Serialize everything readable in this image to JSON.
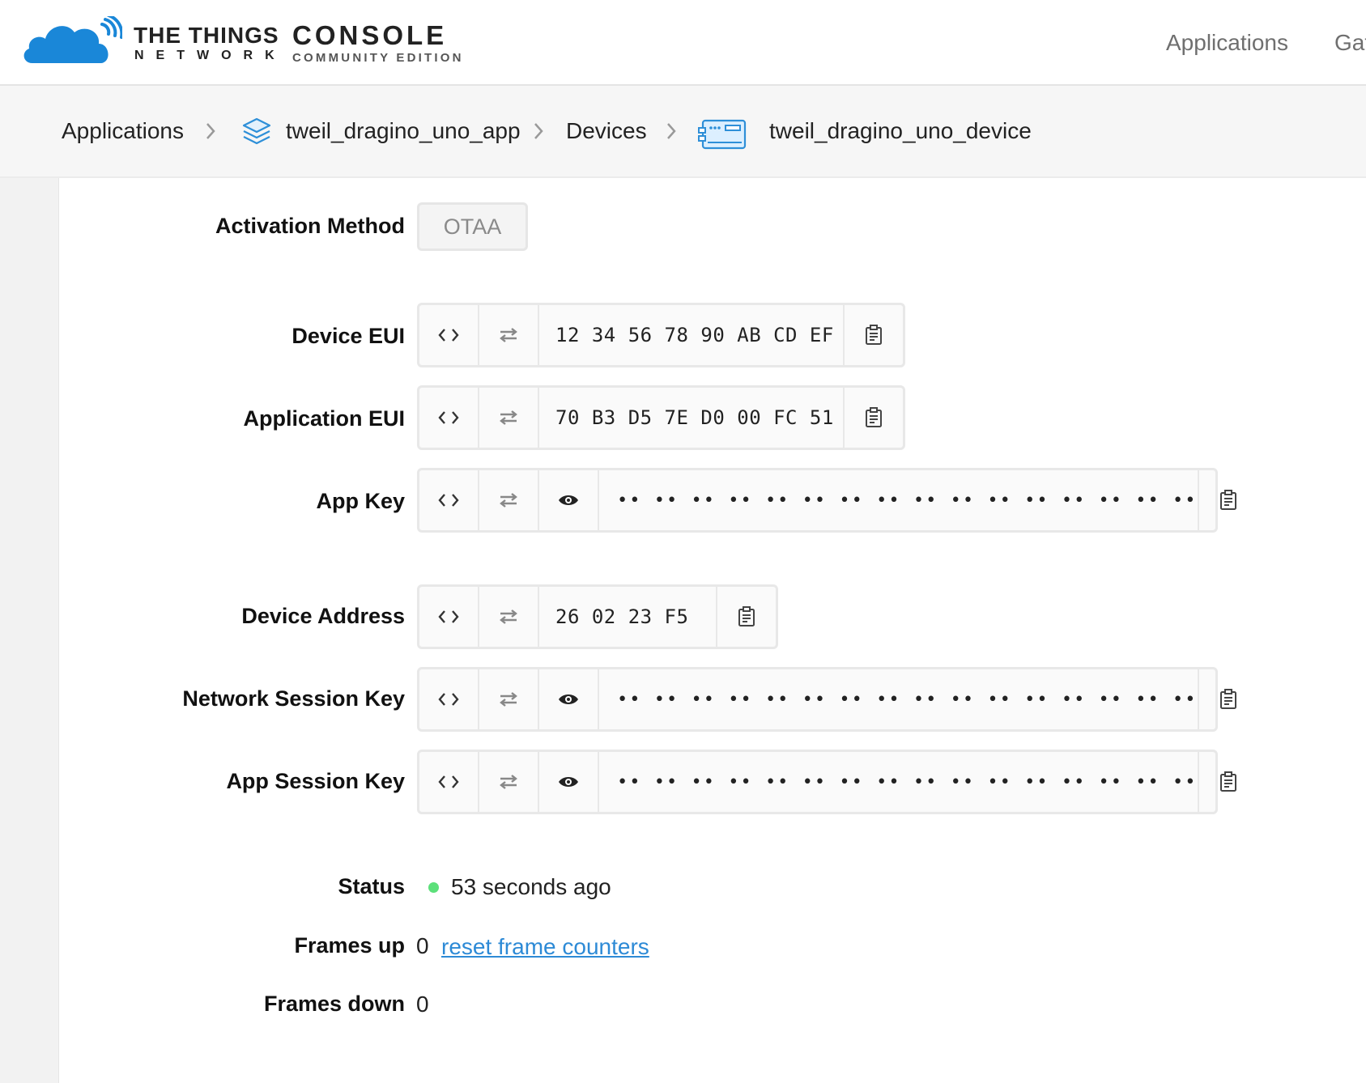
{
  "header": {
    "brand_line1": "THE THINGS",
    "brand_line2": "NETWORK",
    "console_title": "CONSOLE",
    "console_subtitle": "COMMUNITY EDITION",
    "nav": [
      "Applications",
      "Gat"
    ]
  },
  "breadcrumb": {
    "items": [
      "Applications",
      "tweil_dragino_uno_app",
      "Devices",
      "tweil_dragino_uno_device"
    ]
  },
  "fields": {
    "activation_method": {
      "label": "Activation Method",
      "value": "OTAA"
    },
    "device_eui": {
      "label": "Device EUI",
      "value": "12 34 56 78 90 AB CD EF"
    },
    "application_eui": {
      "label": "Application EUI",
      "value": "70 B3 D5 7E D0 00 FC 51"
    },
    "app_key": {
      "label": "App Key",
      "value": "•• •• •• •• •• •• •• •• •• •• •• •• •• •• •• ••"
    },
    "device_address": {
      "label": "Device Address",
      "value": "26 02 23 F5"
    },
    "network_session_key": {
      "label": "Network Session Key",
      "value": "•• •• •• •• •• •• •• •• •• •• •• •• •• •• •• ••"
    },
    "app_session_key": {
      "label": "App Session Key",
      "value": "•• •• •• •• •• •• •• •• •• •• •• •• •• •• •• ••"
    }
  },
  "status": {
    "label": "Status",
    "value": "53 seconds ago",
    "color": "#5ce07a"
  },
  "frames_up": {
    "label": "Frames up",
    "value": "0",
    "reset_link": "reset frame counters"
  },
  "frames_down": {
    "label": "Frames down",
    "value": "0"
  },
  "icons": {
    "format": "code-brackets-icon",
    "byte_order": "swap-arrows-icon",
    "reveal": "eye-icon",
    "copy": "clipboard-icon"
  },
  "colors": {
    "brand_blue": "#1a87d8",
    "link": "#2d8ad6"
  }
}
